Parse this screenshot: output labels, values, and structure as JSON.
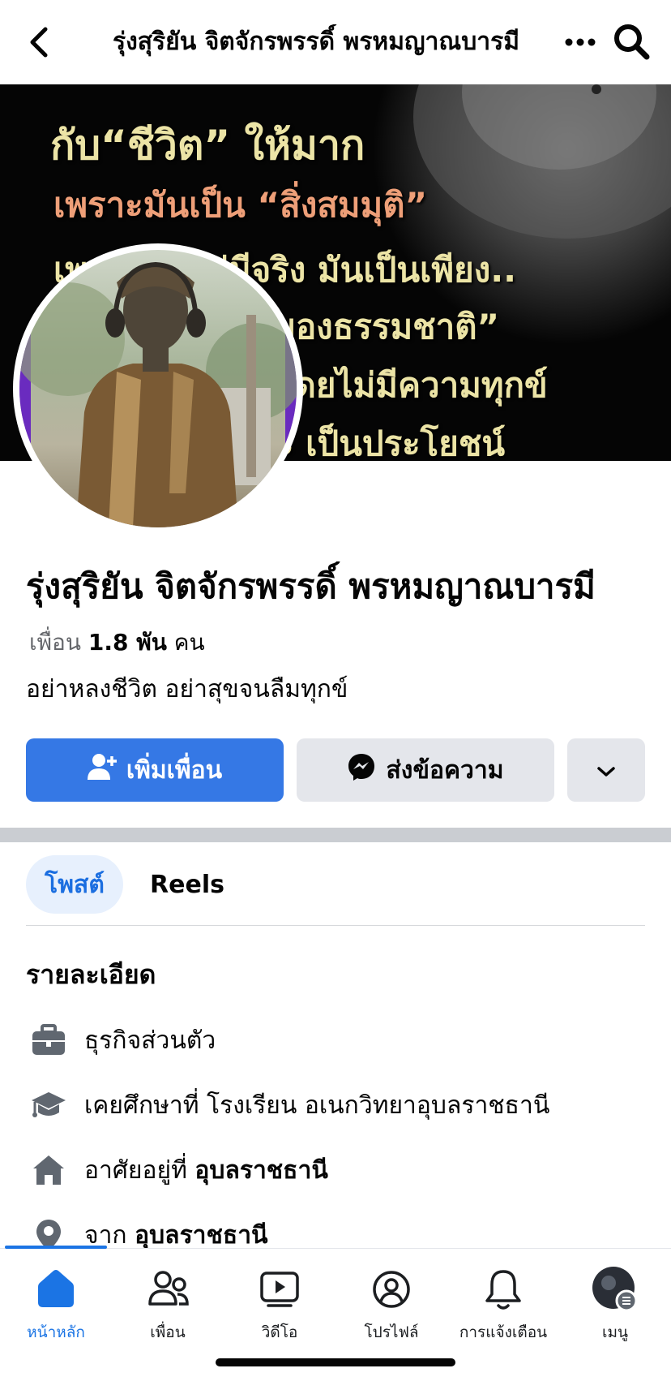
{
  "header": {
    "title": "รุ่งสุริยัน จิตจักรพรรดิ์ พรหมญาณบารมี",
    "back_icon": "chevron-left-icon",
    "more_icon": "more-horizontal-icon",
    "search_icon": "search-icon"
  },
  "cover": {
    "lines": [
      "กับ“ชีวิต” ให้มาก",
      "เพราะมันเป็น “สิ่งสมมุติ”",
      "เพราะมันไม่มีจริง มันเป็นเพียง..",
      "ลงของธรรมชาติ”",
      "โดยไม่มีความทุกข์",
      "ะ เป็นประโยชน์"
    ]
  },
  "profile": {
    "name": "รุ่งสุริยัน จิตจักรพรรดิ์ พรหมญาณบารมี",
    "friends_label": "เพื่อน",
    "friends_count": "1.8 พัน",
    "friends_unit": "คน",
    "bio": "อย่าหลงชีวิต อย่าสุขจนลืมทุกข์"
  },
  "actions": {
    "add_friend": "เพิ่มเพื่อน",
    "message": "ส่งข้อความ"
  },
  "tabs": [
    {
      "label": "โพสต์",
      "active": true
    },
    {
      "label": "Reels",
      "active": false
    }
  ],
  "details": {
    "title": "รายละเอียด",
    "items": [
      {
        "icon": "briefcase-icon",
        "text": "ธุรกิจส่วนตัว",
        "bold": ""
      },
      {
        "icon": "graduation-cap-icon",
        "text": "เคยศึกษาที่ โรงเรียน อเนกวิทยาอุบลราชธานี",
        "bold": ""
      },
      {
        "icon": "home-icon",
        "text": "อาศัยอยู่ที่ ",
        "bold": "อุบลราชธานี"
      },
      {
        "icon": "location-pin-icon",
        "text": "จาก ",
        "bold": "อุบลราชธานี"
      }
    ]
  },
  "nav": {
    "items": [
      {
        "label": "หน้าหลัก",
        "icon": "home-icon",
        "active": true
      },
      {
        "label": "เพื่อน",
        "icon": "friends-icon",
        "active": false
      },
      {
        "label": "วิดีโอ",
        "icon": "video-icon",
        "active": false
      },
      {
        "label": "โปรไฟล์",
        "icon": "profile-icon",
        "active": false
      },
      {
        "label": "การแจ้งเตือน",
        "icon": "bell-icon",
        "active": false
      },
      {
        "label": "เมนู",
        "icon": "menu-avatar-icon",
        "active": false
      }
    ]
  },
  "colors": {
    "accent": "#1b74e4",
    "button_primary": "#3578e5",
    "button_secondary": "#e4e6eb",
    "tab_active_bg": "#e7f0fd"
  }
}
